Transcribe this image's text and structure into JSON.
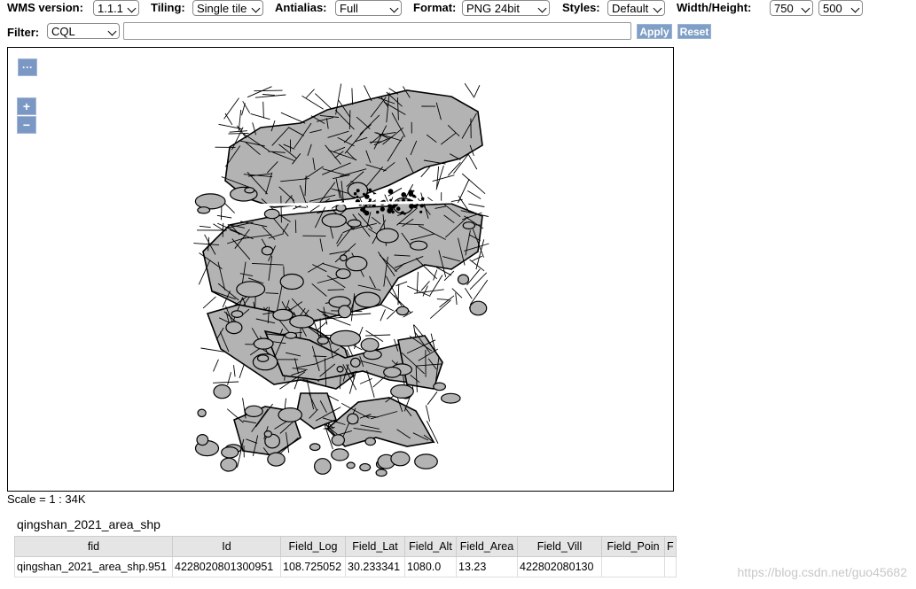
{
  "toolbar": {
    "wms_version_label": "WMS version:",
    "wms_version_value": "1.1.1",
    "tiling_label": "Tiling:",
    "tiling_value": "Single tile",
    "antialias_label": "Antialias:",
    "antialias_value": "Full",
    "format_label": "Format:",
    "format_value": "PNG 24bit",
    "styles_label": "Styles:",
    "styles_value": "Default",
    "size_label": "Width/Height:",
    "width_value": "750",
    "height_value": "500"
  },
  "filter": {
    "label": "Filter:",
    "type_value": "CQL",
    "input_value": "",
    "apply_label": "Apply",
    "reset_label": "Reset"
  },
  "map": {
    "more_button": "···",
    "zoom_in": "+",
    "zoom_out": "−",
    "feature_fill": "#b3b3b3",
    "feature_stroke": "#000000",
    "control_color": "#7b98c4"
  },
  "scale_text": "Scale = 1 : 34K",
  "layer": {
    "title": "qingshan_2021_area_shp",
    "columns": [
      "fid",
      "Id",
      "Field_Log",
      "Field_Lat",
      "Field_Alt",
      "Field_Area",
      "Field_Vill",
      "Field_Poin",
      "F"
    ],
    "row": [
      "qingshan_2021_area_shp.951",
      "4228020801300951",
      "108.725052",
      "30.233341",
      "1080.0",
      "13.23",
      "422802080130",
      "",
      ""
    ]
  },
  "watermark": "https://blog.csdn.net/guo45682"
}
